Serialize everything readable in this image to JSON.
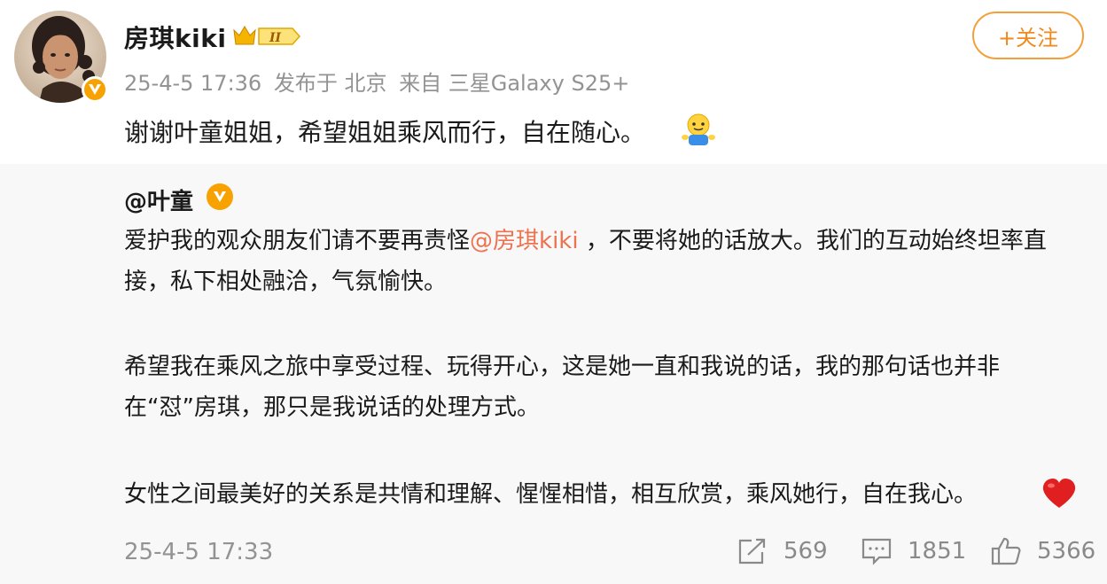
{
  "post": {
    "author": "房琪kiki",
    "follow_label": "+关注",
    "date": "25-4-5 17:36",
    "published_from": "发布于 北京",
    "device": "来自 三星Galaxy S25+",
    "text": "谢谢叶童姐姐，希望姐姐乘风而行，自在随心。"
  },
  "repost": {
    "author": "@叶童",
    "para1_before": "爱护我的观众朋友们请不要再责怪",
    "para1_mention": "@房琪kiki",
    "para1_after": " ，不要将她的话放大。我们的互动始终坦率直接，私下相处融洽，气氛愉快。",
    "para2": "希望我在乘风之旅中享受过程、玩得开心，这是她一直和我说的话，我的那句话也并非在“怼”房琪，那只是我说话的处理方式。",
    "para3": "女性之间最美好的关系是共情和理解、惺惺相惜，相互欣赏，乘风她行，自在我心。",
    "time": "25-4-5 17:33",
    "reposts": "569",
    "comments": "1851",
    "likes": "5366"
  },
  "colors": {
    "accent": "#f08a1c",
    "mention": "#eb7350",
    "verified": "#f7a200",
    "muted": "#939393"
  },
  "icons": [
    "verified-v-icon",
    "vip-crown-badge-icon",
    "emoji-sticker-icon",
    "heart-emoji-icon",
    "repost-icon",
    "comment-icon",
    "like-icon"
  ]
}
